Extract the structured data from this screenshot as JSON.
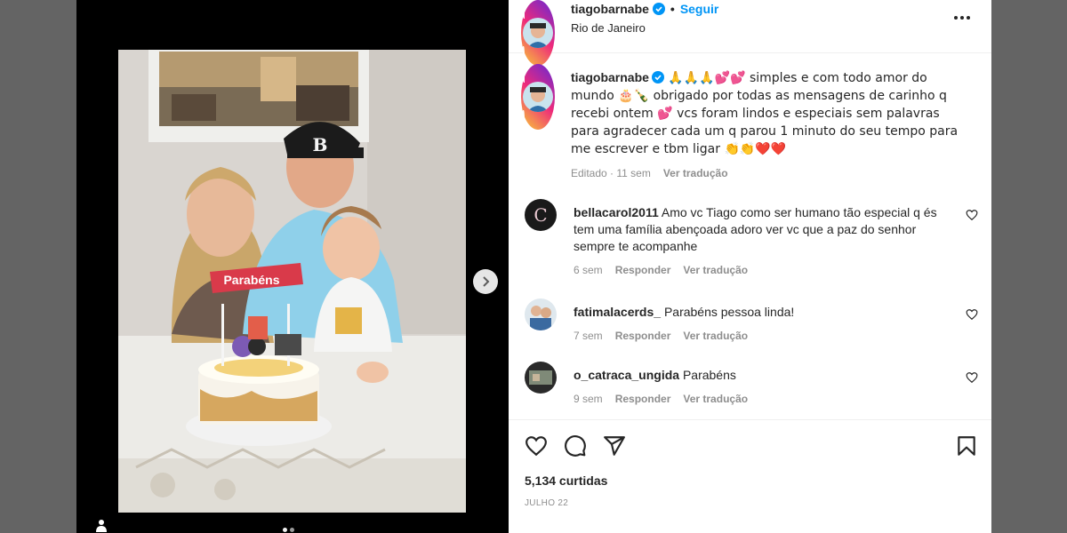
{
  "post": {
    "username": "tiagobarnabe",
    "separator": "•",
    "follow_label": "Seguir",
    "location": "Rio de Janeiro"
  },
  "caption": {
    "username": "tiagobarnabe",
    "text_1": " 🙏🙏🙏💕💕 simples e com todo amor do mundo 🎂🍾 obrigado por todas as mensagens de carinho q recebi ontem 💕 vcs foram lindos e especiais sem palavras para agradecer cada um q parou 1 minuto do seu tempo para me escrever e tbm ligar 👏👏❤️❤️",
    "meta_edited": "Editado · 11 sem",
    "see_translation": "Ver tradução"
  },
  "comments": [
    {
      "username": "bellacarol2011",
      "text": " Amo vc Tiago como ser humano tão especial q és tem uma família abençoada adoro ver vc que a paz do senhor sempre te acompanhe",
      "time": "6 sem",
      "reply": "Responder",
      "translate": "Ver tradução",
      "avatar_letter": "C"
    },
    {
      "username": "fatimalacerds_",
      "text": " Parabéns pessoa linda!",
      "time": "7 sem",
      "reply": "Responder",
      "translate": "Ver tradução"
    },
    {
      "username": "o_catraca_ungida",
      "text": " Parabéns",
      "time": "9 sem",
      "reply": "Responder",
      "translate": "Ver tradução"
    }
  ],
  "photo": {
    "topper_text": "Parabéns",
    "cap_letter": "B"
  },
  "footer": {
    "likes": "5,134 curtidas",
    "date": "JULHO 22"
  },
  "icons": {
    "verified": "verified-badge-icon",
    "more": "more-options-icon",
    "like": "heart-icon",
    "comment": "comment-icon",
    "share": "share-icon",
    "save": "bookmark-icon",
    "next": "chevron-right-icon",
    "user_tag": "user-tag-icon"
  },
  "colors": {
    "link": "#0095f6",
    "text": "#262626",
    "muted": "#8e8e8e",
    "verified": "#0095f6"
  }
}
